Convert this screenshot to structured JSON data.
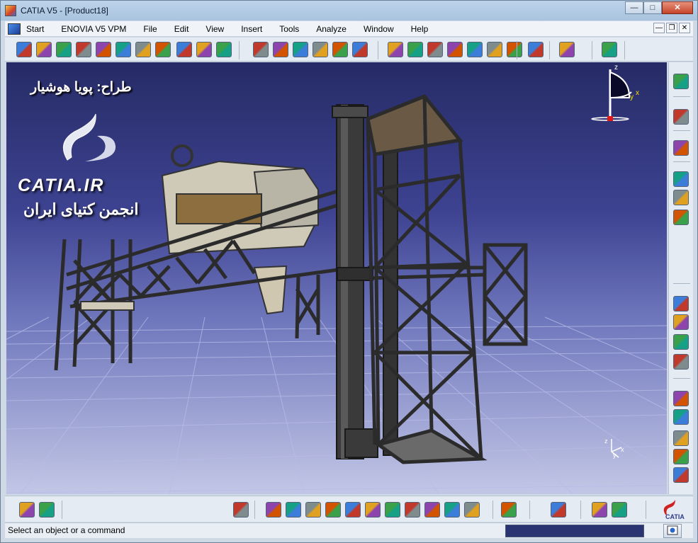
{
  "window": {
    "title": "CATIA V5 - [Product18]",
    "controls": {
      "minimize": "—",
      "maximize": "□",
      "close": "✕"
    }
  },
  "menubar": {
    "items": [
      "Start",
      "ENOVIA V5 VPM",
      "File",
      "Edit",
      "View",
      "Insert",
      "Tools",
      "Analyze",
      "Window",
      "Help"
    ],
    "mdi_controls": {
      "minimize": "—",
      "restore": "❐",
      "close": "✕"
    }
  },
  "viewport": {
    "watermark_designer": "طراح: پویا هوشیار",
    "watermark_brand": "CATIA.IR",
    "watermark_community": "انجمن کتیای ایران",
    "compass_axes": {
      "z": "z",
      "y": "y",
      "x": "x"
    },
    "small_axes": {
      "z": "z",
      "y": "y",
      "x": "x"
    },
    "colors": {
      "background_top": "#262b66",
      "background_bottom": "#c3c7e6",
      "grid": "#9aa0d8",
      "model": "#3a3a3a",
      "model_light": "#cfcab8"
    }
  },
  "top_toolbar": {
    "icons": [
      "fly-mode-icon",
      "fit-all-icon",
      "pan-icon",
      "rotate-icon",
      "zoom-in-icon",
      "zoom-out-icon",
      "normal-view-icon",
      "view-cube-icon",
      "hide-show-icon",
      "swap-space-icon",
      "render-style-icon",
      "catalog-icon",
      "catalog-browser-icon",
      "assembly-constraint-icon",
      "manipulation-icon",
      "snap-icon",
      "explode-icon",
      "stop-icon",
      "bolt-icon",
      "coincidence-icon",
      "contact-icon",
      "offset-icon",
      "angle-icon",
      "fix-icon",
      "reuse-pattern-icon",
      "knowledge-icon",
      "book-icon"
    ]
  },
  "right_toolbar": {
    "icons": [
      "gears-icon",
      "select-arrow-icon",
      "graph-tree-icon",
      "new-component-icon",
      "new-product-icon",
      "new-part-icon",
      "existing-component-icon",
      "existing-positioning-icon",
      "replace-component-icon",
      "reorder-tree-icon",
      "numbering-icon",
      "text-annotation-icon",
      "flag-note-icon",
      "generate-bom-icon",
      "product-table-icon"
    ]
  },
  "bottom_toolbar": {
    "icons": [
      "undo-icon",
      "redo-icon",
      "update-icon",
      "multi-instantiation-icon",
      "fast-instantiation-icon",
      "defeaturing-icon",
      "save-management-icon",
      "scenes-icon",
      "publication-icon",
      "design-table-icon",
      "formula-icon",
      "parameter-icon",
      "capture-icon",
      "camera-icon",
      "measure-icon",
      "section-icon",
      "measure-inertia-icon",
      "mass-icon"
    ],
    "brand_badge": "CATIA"
  },
  "statusbar": {
    "message": "Select an object or a command",
    "command_value": ""
  }
}
